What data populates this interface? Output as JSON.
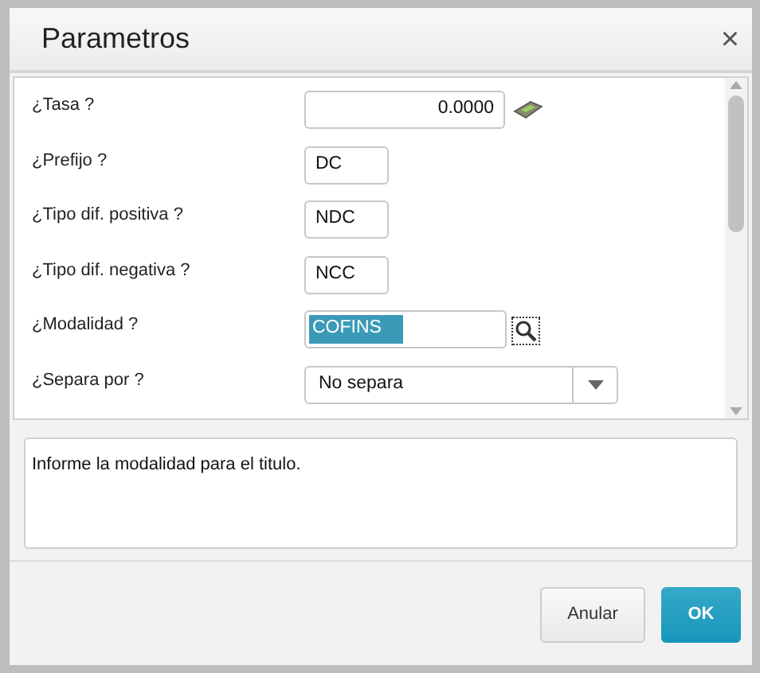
{
  "window": {
    "title": "Parametros",
    "close": "×"
  },
  "params": [
    {
      "label": "¿Tasa ?",
      "kind": "number",
      "value": "0.0000"
    },
    {
      "label": "¿Prefijo ?",
      "kind": "text",
      "value": "DC"
    },
    {
      "label": "¿Tipo dif. positiva ?",
      "kind": "text",
      "value": "NDC"
    },
    {
      "label": "¿Tipo dif. negativa ?",
      "kind": "text",
      "value": "NCC"
    },
    {
      "label": "¿Modalidad ?",
      "kind": "lookup",
      "value": "COFINS",
      "selected": true
    },
    {
      "label": "¿Separa por ?",
      "kind": "select",
      "value": "No separa"
    }
  ],
  "help": {
    "text": "Informe la modalidad para el titulo."
  },
  "buttons": [
    {
      "label": "Anular",
      "kind": "secondary"
    },
    {
      "label": "OK",
      "kind": "primary"
    }
  ]
}
